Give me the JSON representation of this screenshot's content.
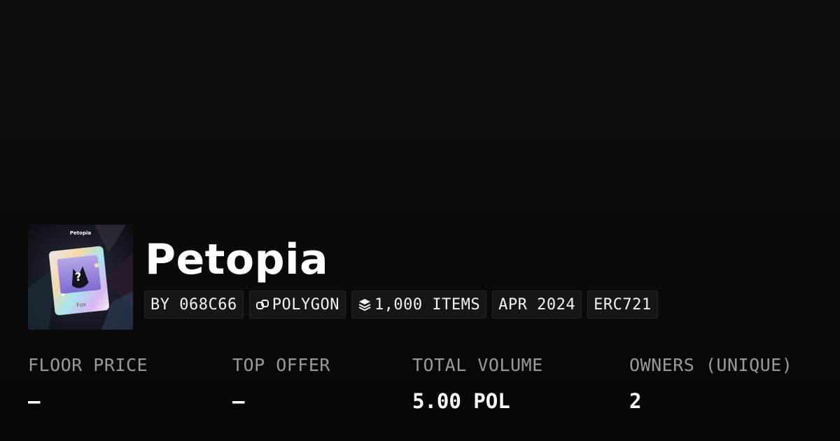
{
  "collection": {
    "title": "Petopia",
    "image_icon": "nft-card-thumbnail",
    "image_logo_text": "Petopia",
    "image_card_label": "Fox"
  },
  "badges": {
    "creator": "BY 068C66",
    "chain": "POLYGON",
    "chain_icon": "polygon-link-icon",
    "items": "1,000 ITEMS",
    "items_icon": "layers-icon",
    "date": "APR 2024",
    "standard": "ERC721"
  },
  "stats": {
    "floor_price": {
      "label": "FLOOR PRICE",
      "value": "–"
    },
    "top_offer": {
      "label": "TOP OFFER",
      "value": "–"
    },
    "total_volume": {
      "label": "TOTAL VOLUME",
      "value": "5.00 POL"
    },
    "owners": {
      "label": "OWNERS (UNIQUE)",
      "value": "2"
    }
  },
  "colors": {
    "background": "#0b0b0b",
    "badge_bg": "#161616",
    "label_gray": "#9a9a9a",
    "text_white": "#ffffff"
  }
}
